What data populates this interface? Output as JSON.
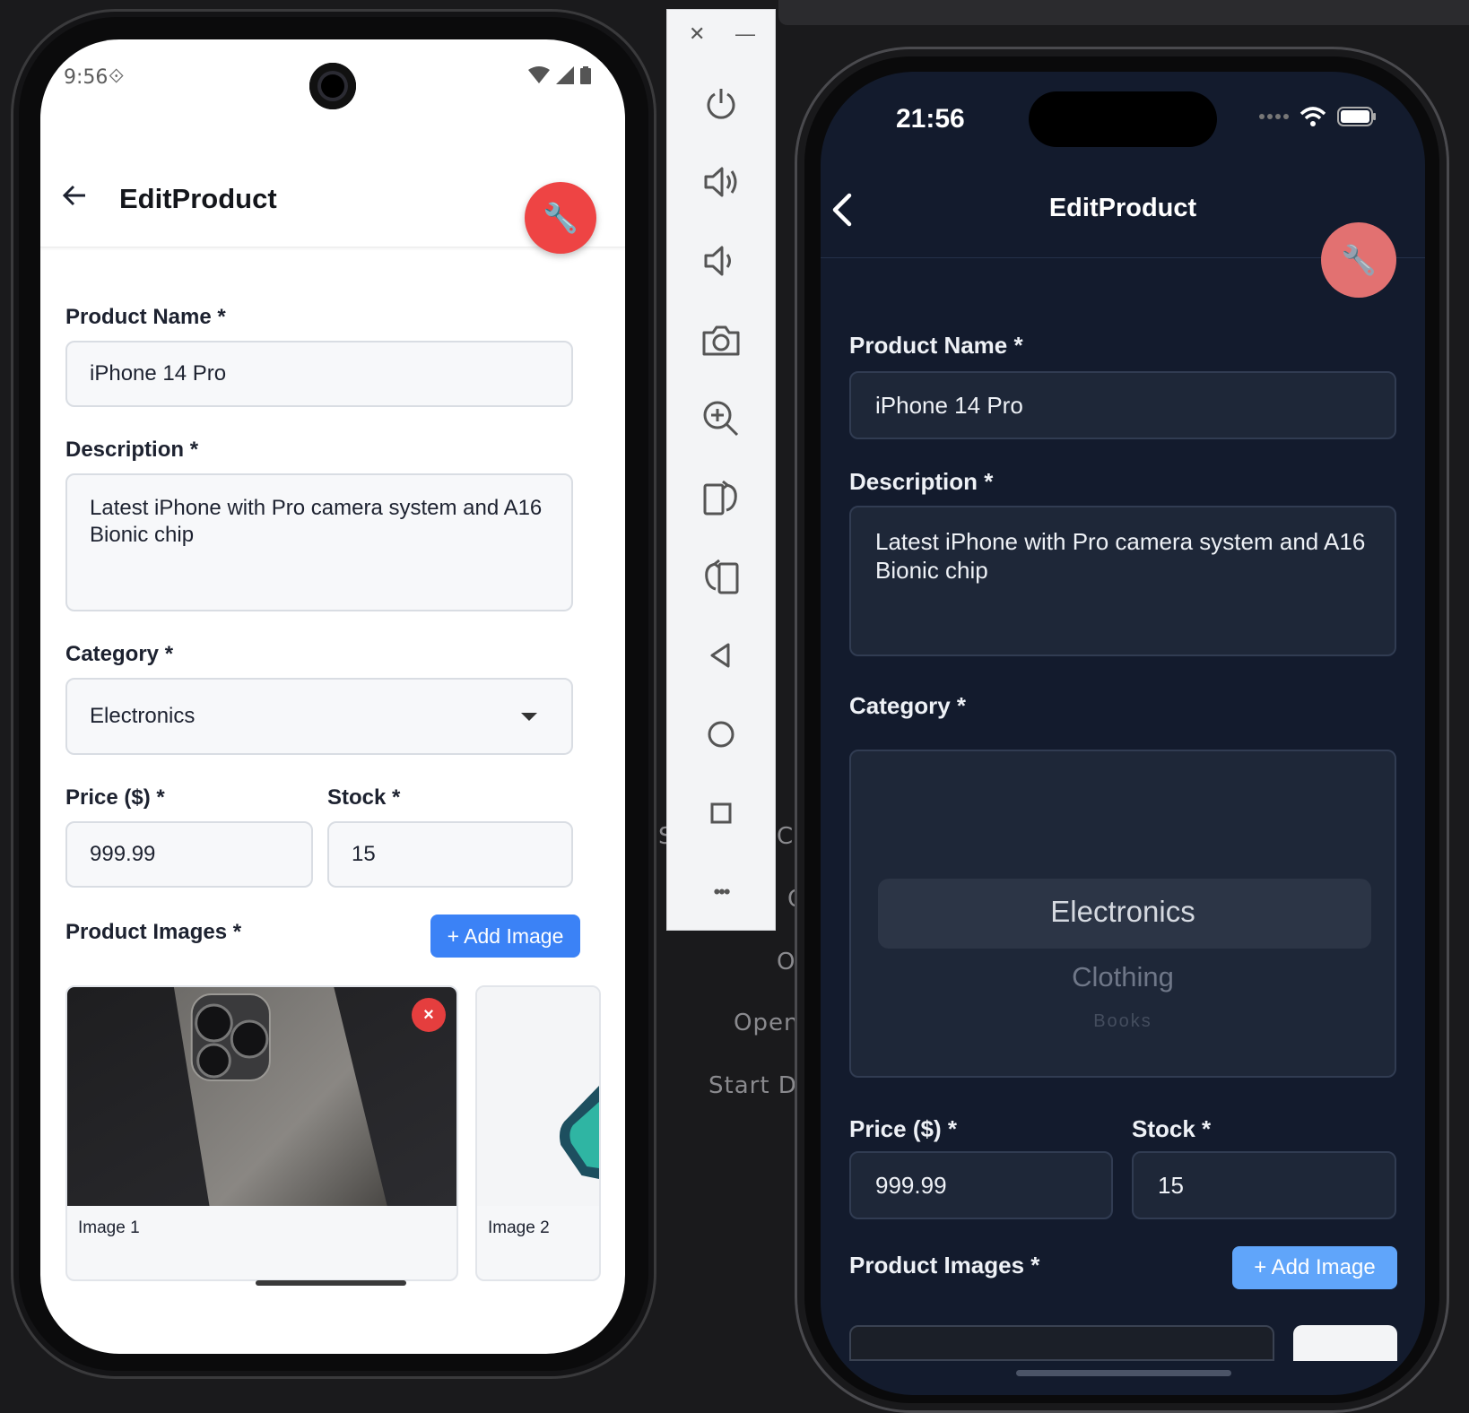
{
  "backdrop": {
    "text_1": "S",
    "text_2": "Co",
    "text_3": "O",
    "text_4": "O",
    "text_5": "Open",
    "text_6": "Start De"
  },
  "android": {
    "status": {
      "time": "9:56"
    },
    "appbar": {
      "title": "EditProduct"
    },
    "form": {
      "product_name_label": "Product Name *",
      "product_name_value": "iPhone 14 Pro",
      "description_label": "Description *",
      "description_value": "Latest iPhone with Pro camera system and A16 Bionic chip",
      "category_label": "Category *",
      "category_value": "Electronics",
      "price_label": "Price ($) *",
      "price_value": "999.99",
      "stock_label": "Stock *",
      "stock_value": "15",
      "images_label": "Product Images *",
      "add_image_label": "+ Add Image",
      "images": [
        {
          "label": "Image 1",
          "remove": "×"
        },
        {
          "label": "Image 2"
        }
      ]
    }
  },
  "ios": {
    "status": {
      "time": "21:56"
    },
    "navbar": {
      "title": "EditProduct"
    },
    "form": {
      "product_name_label": "Product Name *",
      "product_name_value": "iPhone 14 Pro",
      "description_label": "Description *",
      "description_value": "Latest iPhone with Pro camera system and A16 Bionic chip",
      "category_label": "Category *",
      "category_options": [
        "Electronics",
        "Clothing",
        "Books"
      ],
      "category_selected": "Electronics",
      "price_label": "Price ($) *",
      "price_value": "999.99",
      "stock_label": "Stock *",
      "stock_value": "15",
      "images_label": "Product Images *",
      "add_image_label": "+ Add Image"
    }
  },
  "emulator_toolbar": {
    "close": "✕",
    "minimize": "—",
    "more": "•••",
    "icons": [
      "power-icon",
      "volume-up-icon",
      "volume-down-icon",
      "camera-icon",
      "zoom-in-icon",
      "rotate-left-icon",
      "rotate-right-icon",
      "back-icon",
      "home-icon",
      "overview-icon",
      "more-icon"
    ]
  },
  "colors": {
    "fab_red": "#ee4444",
    "primary_blue": "#3b82f6",
    "ios_bg": "#131b2d",
    "ios_fab": "#e27171",
    "ios_button": "#60a5fa"
  }
}
